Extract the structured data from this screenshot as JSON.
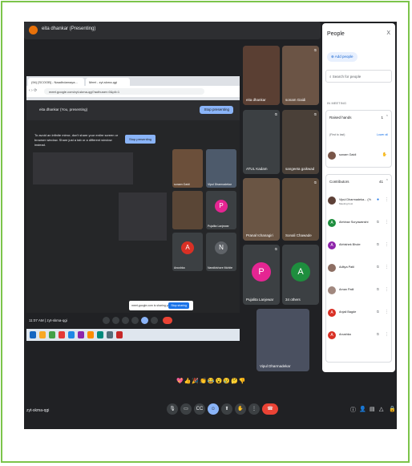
{
  "meeting": {
    "presenter_title": "eita dhankar (Presenting)",
    "meeting_code": "zyt-skma-qgi",
    "reactions": "💖👍🎉👏😂😮😢🤔👎"
  },
  "shared": {
    "tabs": [
      "(94) [SCOOB] - Naadhdamaya...",
      "Meet - zyt-skma-qgi"
    ],
    "url": "meet.google.com/zyt-skma-qgi?authuser=0&pli=1",
    "presenting_text": "eita dhankar (You, presenting)",
    "stop_label": "Stop presenting",
    "warning": "To avoid an infinite mirror, don't share your entire screen or browser window. Share just a tab or a different window instead.",
    "stop_label_2": "Stop presenting",
    "popup_text": "meet.google.com is sharing your screen.",
    "popup_button": "Stop sharing",
    "toast_text": "sonam Gaidi has raised a hand",
    "toast_link": "Open queue",
    "time_code": "11:07 AM  |  zyt-skma-qgi",
    "tiles": [
      {
        "name": "sonam Gaidi",
        "color": "#6b4f3a",
        "letter": ""
      },
      {
        "name": "Vipul Dharmadekar",
        "color": "#4d5a6b",
        "letter": ""
      },
      {
        "name": "",
        "color": "#5a4636",
        "letter": ""
      },
      {
        "name": "Pujalita Lanjewar",
        "color": "#3c4043",
        "letter": "P",
        "circle": "#e52592"
      },
      {
        "name": "Anushka",
        "color": "#3c4043",
        "letter": "A",
        "circle": "#d93025"
      },
      {
        "name": "Nandkishore Mohite",
        "color": "#3c4043",
        "letter": "N",
        "circle": "#5f6368"
      }
    ]
  },
  "grid": [
    {
      "name": "eita dhankar",
      "color": "#5a3f33",
      "letter": ""
    },
    {
      "name": "sonam Gaidi",
      "color": "#6b5445",
      "letter": ""
    },
    {
      "name": "ATUL Kadam",
      "color": "#3c4043",
      "letter": ""
    },
    {
      "name": "sangeeta gaikwad",
      "color": "#4a4038",
      "letter": ""
    },
    {
      "name": "Pranal Ichanagiri",
      "color": "#6a5544",
      "letter": ""
    },
    {
      "name": "Sonali Chawade",
      "color": "#5c4a3a",
      "letter": ""
    },
    {
      "name": "Pujalita Lanjewar",
      "color": "#3c4043",
      "letter": "P",
      "circle": "#e52592"
    },
    {
      "name": "34 others",
      "color": "#3c4043",
      "letter": "A",
      "circle": "#1e8e3e"
    },
    {
      "name": "Vipul Dharmadekar",
      "color": "#4a5060",
      "letter": ""
    }
  ],
  "people_panel": {
    "title": "People",
    "close": "X",
    "add_people": "Add people",
    "search_placeholder": "Search for people",
    "in_meeting_label": "IN MEETING",
    "raised_hands_label": "Raised hands",
    "raised_hands_count": "1",
    "first_to_last": "(First to last)",
    "lower_all": "Lower all",
    "raised": [
      {
        "name": "sonam Gaidi",
        "color": "#795548",
        "icon": "✋"
      }
    ],
    "contributors_label": "Contributors",
    "contributors_count": "41",
    "contributors": [
      {
        "name": "Vipul Dharmadeka... (You)",
        "sub": "Meeting host",
        "color": "#5d4037",
        "letter": ""
      },
      {
        "name": "Abhinav Suryawanshi",
        "sub": "",
        "color": "#1e8e3e",
        "letter": "A"
      },
      {
        "name": "Abhishek Bhute",
        "sub": "",
        "color": "#8e24aa",
        "letter": "A"
      },
      {
        "name": "Aditya Patil",
        "sub": "",
        "color": "#8d6e63",
        "letter": ""
      },
      {
        "name": "Aman Patil",
        "sub": "",
        "color": "#a1887f",
        "letter": ""
      },
      {
        "name": "Anjali Bagde",
        "sub": "",
        "color": "#d93025",
        "letter": "A"
      },
      {
        "name": "Anushka",
        "sub": "",
        "color": "#d93025",
        "letter": "A"
      }
    ]
  },
  "colors": {
    "background": "#202124",
    "accent": "#8ab4f8",
    "end_call": "#ea4335",
    "frame_border": "#7cc44a"
  }
}
